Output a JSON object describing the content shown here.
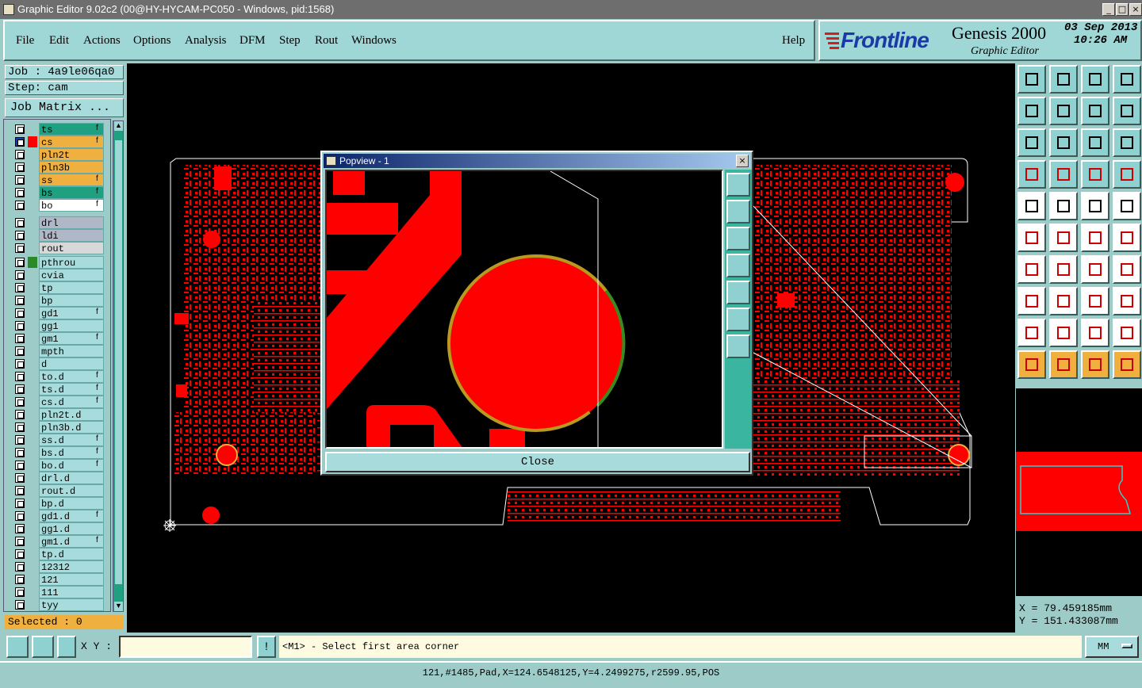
{
  "window": {
    "title": "Graphic Editor 9.02c2 (00@HY-HYCAM-PC050 - Windows, pid:1568)"
  },
  "menu": {
    "items": [
      "File",
      "Edit",
      "Actions",
      "Options",
      "Analysis",
      "DFM",
      "Step",
      "Rout",
      "Windows"
    ],
    "help": "Help"
  },
  "brand": {
    "logo": "Frontline",
    "product": "Genesis 2000",
    "subtitle": "Graphic Editor",
    "date": "03 Sep 2013",
    "time": "10:26 AM"
  },
  "job": {
    "job_label": "Job : 4a9le06qa0",
    "step_label": "Step: cam",
    "matrix_button": "Job Matrix ..."
  },
  "layers": {
    "group1": [
      {
        "name": "ts",
        "color": "#1fa080",
        "mark": "f"
      },
      {
        "name": "cs",
        "color": "#f0b040",
        "mark": "f",
        "active": true
      },
      {
        "name": "pln2t",
        "color": "#f0b040",
        "mark": ""
      },
      {
        "name": "pln3b",
        "color": "#f0b040",
        "mark": ""
      },
      {
        "name": "ss",
        "color": "#f0b040",
        "mark": "f"
      },
      {
        "name": "bs",
        "color": "#1fa080",
        "mark": "f"
      },
      {
        "name": "bo",
        "color": "#ffffff",
        "mark": "f"
      }
    ],
    "group2": [
      {
        "name": "drl",
        "color": "#b0b8c8",
        "mark": ""
      },
      {
        "name": "ldi",
        "color": "#b0b8c8",
        "mark": ""
      },
      {
        "name": "rout",
        "color": "#d8d8d8",
        "mark": ""
      }
    ],
    "group3": [
      {
        "name": "pthrou",
        "color": "#a8dcdc",
        "mark": ""
      },
      {
        "name": "cvia",
        "color": "#a8dcdc",
        "mark": ""
      },
      {
        "name": "tp",
        "color": "#a8dcdc",
        "mark": ""
      },
      {
        "name": "bp",
        "color": "#a8dcdc",
        "mark": ""
      },
      {
        "name": "gd1",
        "color": "#a8dcdc",
        "mark": "f"
      },
      {
        "name": "gg1",
        "color": "#a8dcdc",
        "mark": ""
      },
      {
        "name": "gm1",
        "color": "#a8dcdc",
        "mark": "f"
      },
      {
        "name": "mpth",
        "color": "#a8dcdc",
        "mark": ""
      },
      {
        "name": "d",
        "color": "#a8dcdc",
        "mark": ""
      },
      {
        "name": "to.d",
        "color": "#a8dcdc",
        "mark": "f"
      },
      {
        "name": "ts.d",
        "color": "#a8dcdc",
        "mark": "f"
      },
      {
        "name": "cs.d",
        "color": "#a8dcdc",
        "mark": "f"
      },
      {
        "name": "pln2t.d",
        "color": "#a8dcdc",
        "mark": ""
      },
      {
        "name": "pln3b.d",
        "color": "#a8dcdc",
        "mark": ""
      },
      {
        "name": "ss.d",
        "color": "#a8dcdc",
        "mark": "f"
      },
      {
        "name": "bs.d",
        "color": "#a8dcdc",
        "mark": "f"
      },
      {
        "name": "bo.d",
        "color": "#a8dcdc",
        "mark": "f"
      },
      {
        "name": "drl.d",
        "color": "#a8dcdc",
        "mark": ""
      },
      {
        "name": "rout.d",
        "color": "#a8dcdc",
        "mark": ""
      },
      {
        "name": "bp.d",
        "color": "#a8dcdc",
        "mark": ""
      },
      {
        "name": "gd1.d",
        "color": "#a8dcdc",
        "mark": "f"
      },
      {
        "name": "gg1.d",
        "color": "#a8dcdc",
        "mark": ""
      },
      {
        "name": "gm1.d",
        "color": "#a8dcdc",
        "mark": "f"
      },
      {
        "name": "tp.d",
        "color": "#a8dcdc",
        "mark": ""
      },
      {
        "name": "12312",
        "color": "#a8dcdc",
        "mark": ""
      },
      {
        "name": "121",
        "color": "#a8dcdc",
        "mark": ""
      },
      {
        "name": "111",
        "color": "#a8dcdc",
        "mark": ""
      },
      {
        "name": "tyy",
        "color": "#a8dcdc",
        "mark": ""
      }
    ]
  },
  "selected": "Selected : 0",
  "popview": {
    "title": "Popview - 1",
    "close": "Close"
  },
  "coords": {
    "x": "X = 79.459185mm",
    "y": "Y = 151.433087mm"
  },
  "status": {
    "xy_label": "X Y :",
    "xy_value": "",
    "prompt": "<M1> - Select first area corner",
    "units": "MM",
    "info": "121,#1485,Pad,X=124.6548125,Y=4.2499275,r2599.95,POS"
  },
  "colors": {
    "copper": "#ff0000",
    "outline": "#ffffff",
    "canvas": "#000000",
    "panel": "#9ccbc8",
    "highlight": "#f0b040"
  }
}
